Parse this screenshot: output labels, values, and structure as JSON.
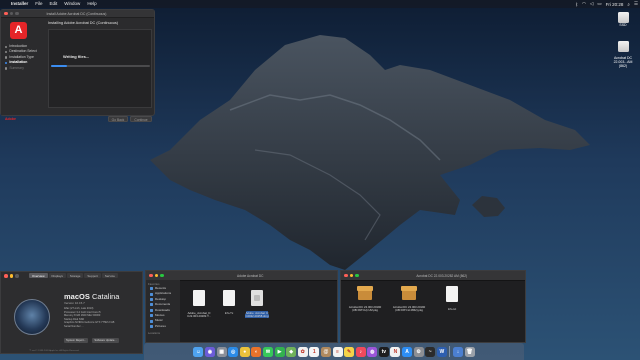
{
  "menubar": {
    "apple": "",
    "app": "Installer",
    "menus": [
      "File",
      "Edit",
      "Window",
      "Help"
    ],
    "clock": "Fri 20:28"
  },
  "installer": {
    "title": "Install Adobe Acrobat DC (Continuous)",
    "heading": "Installing Adobe Acrobat DC (Continuous)",
    "status": "Writing files...",
    "progress": 0.16,
    "steps": [
      {
        "label": "Introduction",
        "state": "done"
      },
      {
        "label": "Destination Select",
        "state": "done"
      },
      {
        "label": "Installation Type",
        "state": "done"
      },
      {
        "label": "Installation",
        "state": "current"
      },
      {
        "label": "Summary",
        "state": "pending"
      }
    ],
    "brand": "Adobe",
    "back_label": "Go Back",
    "continue_label": "Continue"
  },
  "desktop_icons": [
    {
      "label": "SSD",
      "icon": "internal-drive-icon"
    },
    {
      "label": "Acrobat DC\n22.003...AM (862)",
      "icon": "removable-drive-icon"
    }
  ],
  "about": {
    "tabs": [
      "Overview",
      "Displays",
      "Storage",
      "Support",
      "Service"
    ],
    "os_name_bold": "macOS",
    "os_name": "Catalina",
    "version": "Version 10.15.7",
    "specs": [
      "iMac (27-inch, Late 2013)",
      "Processor   3.4 GHz Intel Core i5",
      "Memory   8 GB 1600 MHz DDR3",
      "Startup Disk   SSD",
      "Graphics   NVIDIA GeForce GTX 775M 2 GB",
      "Serial Number   ..."
    ],
    "report_label": "System Report...",
    "update_label": "Software Update...",
    "copyright": "™ and © 1983-2020 Apple Inc. All Rights Reserved."
  },
  "finder1": {
    "title": "Adobe Acrobat DC",
    "sidebar_header": "Favorites",
    "sidebar": [
      "Recents",
      "Applications",
      "Desktop",
      "Documents",
      "Downloads",
      "Movies",
      "Music",
      "Pictures"
    ],
    "sidebar_header2": "Locations",
    "files": [
      {
        "name": "Adobe_Acrobat_D\nC22.003.20282.T...",
        "type": "doc"
      },
      {
        "name": "Info.Tx",
        "type": "doc"
      },
      {
        "name": "Adobe_Acrobat_D\nC2022.20258.dmg",
        "type": "dmg",
        "selected": true
      }
    ]
  },
  "finder2": {
    "title": "Acrobat DC 22.003.20282 AM (862)",
    "files": [
      {
        "name": "Acrobat DC 22.003.20190\n(UB PATCH) UM.pkg",
        "type": "pkg"
      },
      {
        "name": "Acrobat DC 22.003.20190\n(UB PATCH 2862).pkg",
        "type": "pkg"
      },
      {
        "name": "Info.txt",
        "type": "doc"
      }
    ]
  },
  "dock": [
    {
      "name": "finder-icon",
      "color": "#4fa3f0",
      "glyph": "☺"
    },
    {
      "name": "siri-icon",
      "color": "#6b5cd8",
      "glyph": "◉"
    },
    {
      "name": "launchpad-icon",
      "color": "#8a8f99",
      "glyph": "▦"
    },
    {
      "name": "safari-icon",
      "color": "#2b8be8",
      "glyph": "◎"
    },
    {
      "name": "chrome-icon",
      "color": "#e9c23c",
      "glyph": "●"
    },
    {
      "name": "firefox-icon",
      "color": "#e8722a",
      "glyph": "◐"
    },
    {
      "name": "messages-icon",
      "color": "#36c85a",
      "glyph": "✉"
    },
    {
      "name": "facetime-icon",
      "color": "#32b24f",
      "glyph": "▶"
    },
    {
      "name": "maps-icon",
      "color": "#6fb25a",
      "glyph": "◆"
    },
    {
      "name": "photos-icon",
      "color": "#f0f0f0",
      "glyph": "✿"
    },
    {
      "name": "calendar-icon",
      "color": "#f5f5f5",
      "glyph": "1"
    },
    {
      "name": "contacts-icon",
      "color": "#b08a5f",
      "glyph": "@"
    },
    {
      "name": "reminders-icon",
      "color": "#f2f2f2",
      "glyph": "≡"
    },
    {
      "name": "notes-icon",
      "color": "#f6d349",
      "glyph": "✎"
    },
    {
      "name": "music-icon",
      "color": "#f04a5c",
      "glyph": "♪"
    },
    {
      "name": "podcasts-icon",
      "color": "#9b55d9",
      "glyph": "◍"
    },
    {
      "name": "tv-icon",
      "color": "#1d1d1f",
      "glyph": "tv"
    },
    {
      "name": "news-icon",
      "color": "#f2f2f2",
      "glyph": "N"
    },
    {
      "name": "app-store-icon",
      "color": "#2d8ef5",
      "glyph": "A"
    },
    {
      "name": "system-preferences-icon",
      "color": "#8d8f94",
      "glyph": "⚙"
    },
    {
      "name": "activity-monitor-icon",
      "color": "#2b2b2b",
      "glyph": "~"
    },
    {
      "name": "word-icon",
      "color": "#2e5fb0",
      "glyph": "W"
    },
    {
      "name": "downloads-stack-icon",
      "color": "#4b7fd0",
      "glyph": "↓"
    },
    {
      "name": "trash-icon",
      "color": "#9aa0a8",
      "glyph": "🗑"
    }
  ]
}
